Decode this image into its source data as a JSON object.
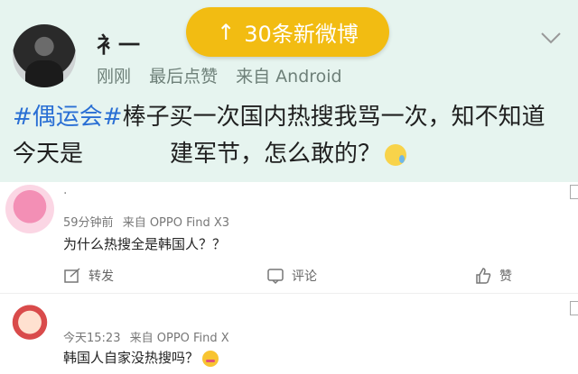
{
  "post": {
    "username": "衤一",
    "meta": [
      "刚刚",
      "最后点赞",
      "来自 Android"
    ],
    "banner": "30条新微博",
    "hashtag": "#偶运会#",
    "text_line1": "棒子买一次国内热搜我骂一次，知不知道",
    "text_line2": "今天是",
    "text_line2_end": "建军节，怎么敢的？"
  },
  "comments": [
    {
      "name": "·",
      "time": "59分钟前",
      "source": "来自 OPPO Find X3",
      "text": "为什么热搜全是韩国人？？",
      "actions": {
        "repost": "转发",
        "comment": "评论",
        "like": "赞"
      }
    },
    {
      "time": "今天15:23",
      "source": "来自 OPPO Find X",
      "text": "韩国人自家没热搜吗？"
    }
  ]
}
